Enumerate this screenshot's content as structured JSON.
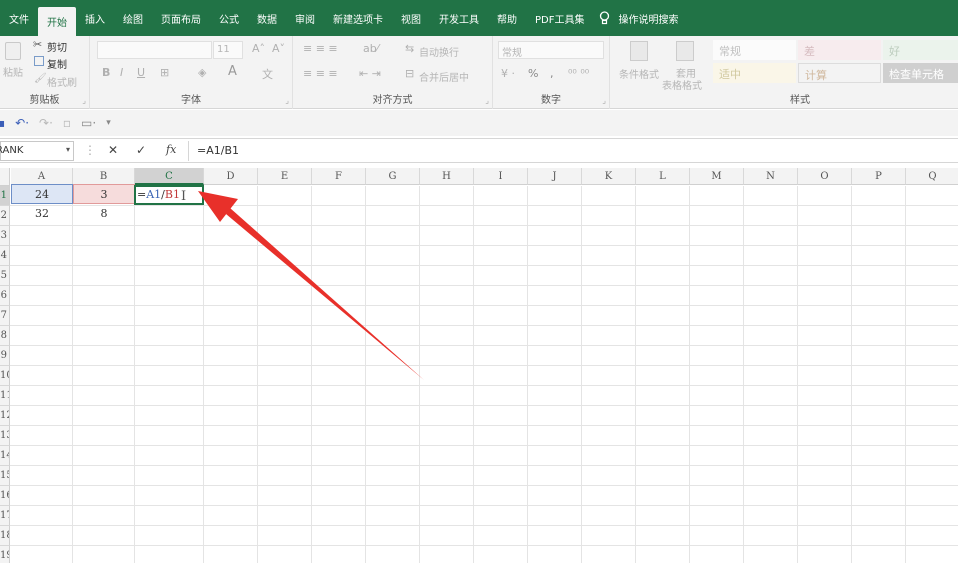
{
  "menu": {
    "tabs": [
      "文件",
      "开始",
      "插入",
      "绘图",
      "页面布局",
      "公式",
      "数据",
      "审阅",
      "新建选项卡",
      "视图",
      "开发工具",
      "帮助",
      "PDF工具集"
    ],
    "active_tab": "开始",
    "tell_me": "操作说明搜索"
  },
  "ribbon": {
    "clipboard": {
      "paste": "粘贴",
      "cut": "剪切",
      "copy": "复制",
      "format_painter": "格式刷",
      "label": "剪贴板"
    },
    "font": {
      "size": "11",
      "bold": "B",
      "italic": "I",
      "underline": "U",
      "font_color": "A",
      "label": "字体"
    },
    "alignment": {
      "wrap_text": "自动换行",
      "merge_center": "合并后居中",
      "label": "对齐方式"
    },
    "number": {
      "format": "常规",
      "percent": "%",
      "comma": ",",
      "label": "数字"
    },
    "styles": {
      "conditional": "条件格式",
      "table_format_1": "套用",
      "table_format_2": "表格格式",
      "normal": "常规",
      "bad": "差",
      "good": "好",
      "neutral": "适中",
      "calculation": "计算",
      "check_cell": "检查单元格",
      "label": "样式"
    }
  },
  "formula_bar": {
    "name_box": "RANK",
    "cancel": "✕",
    "enter": "✓",
    "fx": "fx",
    "content": "=A1/B1"
  },
  "grid": {
    "columns": [
      "A",
      "B",
      "C",
      "D",
      "E",
      "F",
      "G",
      "H",
      "I",
      "J",
      "K",
      "L",
      "M",
      "N",
      "O",
      "P",
      "Q"
    ],
    "rows": [
      "1",
      "2",
      "3",
      "4",
      "5",
      "6",
      "7",
      "8",
      "9",
      "10",
      "11",
      "12",
      "13",
      "14",
      "15",
      "16",
      "17",
      "18",
      "19"
    ],
    "cells": {
      "A1": "24",
      "B1": "3",
      "A2": "32",
      "B2": "8",
      "C1_part1": "=",
      "C1_ref_a": "A1",
      "C1_op": "/",
      "C1_ref_b": "B1"
    }
  },
  "colors": {
    "excel_green": "#217346",
    "arrow_red": "#e8302a",
    "ref_a_blue": "#3a64b4",
    "ref_b_red": "#c23a3a"
  }
}
